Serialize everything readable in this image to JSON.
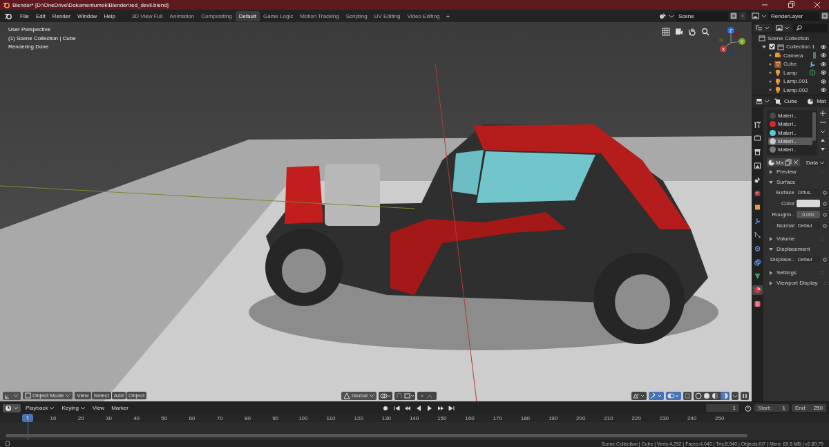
{
  "window": {
    "title": "Blender* [D:\\OneDrive\\Dokumentumok\\Blender\\red_devil.blend]"
  },
  "menu": [
    "File",
    "Edit",
    "Render",
    "Window",
    "Help"
  ],
  "workspaces": [
    {
      "label": "3D View Full",
      "selected": false
    },
    {
      "label": "Animation",
      "selected": false
    },
    {
      "label": "Compositing",
      "selected": false
    },
    {
      "label": "Default",
      "selected": true
    },
    {
      "label": "Game Logic",
      "selected": false
    },
    {
      "label": "Motion Tracking",
      "selected": false
    },
    {
      "label": "Scripting",
      "selected": false
    },
    {
      "label": "UV Editing",
      "selected": false
    },
    {
      "label": "Video Editing",
      "selected": false
    }
  ],
  "add_workspace": "+",
  "scene": "Scene",
  "render_layer": "RenderLayer",
  "viewport": {
    "overlay_text": [
      "User Perspective",
      "(1) Scene Collection | Cube",
      "Rendering Done"
    ],
    "gizmo_axes": [
      "Z",
      "Y",
      "X"
    ],
    "mode": "Object Mode",
    "menus": [
      "View",
      "Select",
      "Add",
      "Object"
    ],
    "orientation": "Global"
  },
  "outliner": {
    "root": "Scene Collection",
    "collection": {
      "label": "Collection 1",
      "checked": true,
      "expanded": true,
      "children": [
        {
          "label": "Camera",
          "kind": "camera"
        },
        {
          "label": "Cube",
          "kind": "mesh"
        },
        {
          "label": "Lamp",
          "kind": "light-linked"
        },
        {
          "label": "Lamp.001",
          "kind": "light"
        },
        {
          "label": "Lamp.002",
          "kind": "light"
        }
      ]
    }
  },
  "properties": {
    "object": "Cube",
    "tab_label": "Mat",
    "tabs": [
      {
        "kind": "tool",
        "selected": false
      },
      {
        "kind": "render",
        "selected": false
      },
      {
        "kind": "output",
        "selected": false
      },
      {
        "kind": "view-layer",
        "selected": false
      },
      {
        "kind": "scene",
        "selected": false
      },
      {
        "kind": "world",
        "selected": false
      },
      {
        "kind": "object",
        "selected": false
      },
      {
        "kind": "modifier",
        "selected": false
      },
      {
        "kind": "particles",
        "selected": false
      },
      {
        "kind": "physics",
        "selected": false
      },
      {
        "kind": "constraints",
        "selected": false
      },
      {
        "kind": "data",
        "selected": false
      },
      {
        "kind": "material",
        "selected": true
      },
      {
        "kind": "texture",
        "selected": false
      }
    ],
    "materials": [
      {
        "name": "Materi..",
        "color": "#4a4a4a",
        "selected": false
      },
      {
        "name": "Materi..",
        "color": "#d42a2a",
        "selected": false
      },
      {
        "name": "Materi..",
        "color": "#5ec9d2",
        "selected": false
      },
      {
        "name": "Materi..",
        "color": "#c9c9c9",
        "selected": true
      },
      {
        "name": "Materi..",
        "color": "#7a7a7a",
        "selected": false
      }
    ],
    "material_field": "Ma",
    "link": "Data",
    "sections": [
      {
        "title": "Preview",
        "expanded": false
      },
      {
        "title": "Surface",
        "expanded": true,
        "rows": [
          {
            "label": "Surface",
            "kind": "menu",
            "value": "Diffus.."
          },
          {
            "label": "Color",
            "kind": "color",
            "color": "#d9d9d9"
          },
          {
            "label": "Roughn..",
            "kind": "number",
            "value": "0.000"
          },
          {
            "label": "Normal",
            "kind": "menu",
            "value": "Defaul"
          }
        ]
      },
      {
        "title": "Volume",
        "expanded": false
      },
      {
        "title": "Displacement",
        "expanded": true,
        "rows": [
          {
            "label": "Displace..",
            "kind": "menu",
            "value": "Defaul"
          }
        ]
      },
      {
        "title": "Settings",
        "expanded": false
      },
      {
        "title": "Viewport Display",
        "expanded": false
      }
    ]
  },
  "timeline": {
    "menus": [
      "Playback",
      "Keying",
      "View",
      "Marker"
    ],
    "current_frame": "1",
    "start_label": "Start:",
    "start": "1",
    "end_label": "End:",
    "end": "250",
    "ruler_current": "1",
    "ticks": [
      "10",
      "20",
      "30",
      "40",
      "50",
      "60",
      "70",
      "80",
      "90",
      "100",
      "110",
      "120",
      "130",
      "140",
      "150",
      "160",
      "170",
      "180",
      "190",
      "200",
      "210",
      "220",
      "230",
      "240",
      "250"
    ]
  },
  "status_bar": "Scene Collection | Cube | Verts:4,292 | Faces:4,042 | Tris:8,540 | Objects:0/7 | Mem: 69.5 MB | v2.80.75"
}
